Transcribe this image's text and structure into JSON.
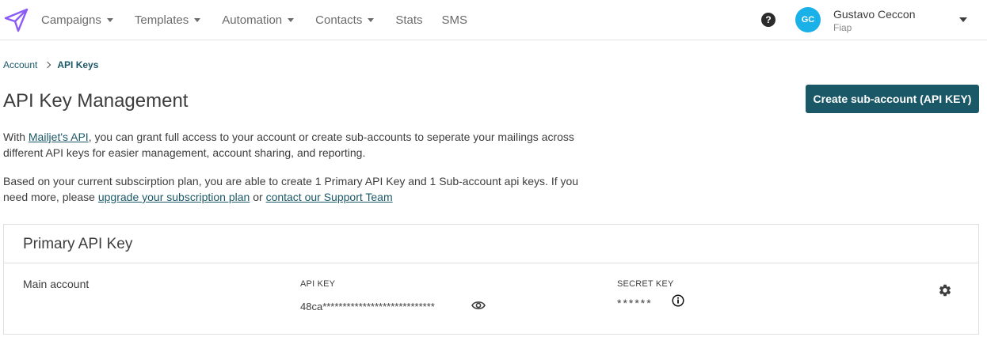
{
  "nav": {
    "items": [
      {
        "label": "Campaigns",
        "dropdown": true
      },
      {
        "label": "Templates",
        "dropdown": true
      },
      {
        "label": "Automation",
        "dropdown": true
      },
      {
        "label": "Contacts",
        "dropdown": true
      },
      {
        "label": "Stats",
        "dropdown": false
      },
      {
        "label": "SMS",
        "dropdown": false
      }
    ],
    "help_symbol": "?",
    "user": {
      "initials": "GC",
      "name": "Gustavo Ceccon",
      "org": "Fiap"
    }
  },
  "breadcrumb": {
    "parent": "Account",
    "current": "API Keys"
  },
  "page": {
    "title": "API Key Management",
    "cta_label": "Create sub-account (API KEY)",
    "desc1": {
      "prefix": "With ",
      "link": "Mailjet's API",
      "suffix": ", you can grant full access to your account or create sub-accounts to seperate your mailings across different API keys for easier management, account sharing, and reporting."
    },
    "desc2": {
      "prefix": "Based on your current subscirption plan, you are able to create 1 Primary API Key and 1 Sub-account api keys. If you need more, please ",
      "link1": "upgrade your subscription plan",
      "middle": " or ",
      "link2": "contact our Support Team"
    }
  },
  "primary_key": {
    "title": "Primary API Key",
    "account_name": "Main account",
    "api_key_label": "API KEY",
    "api_key_value": "48ca****************************",
    "secret_key_label": "SECRET KEY",
    "secret_key_value": "******"
  },
  "colors": {
    "brand_purple": "#8a5cf5",
    "primary_teal": "#1a5867",
    "avatar_blue": "#1ab0e8"
  },
  "icons": {
    "logo": "paper-plane-icon",
    "help": "help-circle-icon",
    "eye": "eye-icon",
    "info": "info-icon",
    "settings": "gear-icon"
  }
}
